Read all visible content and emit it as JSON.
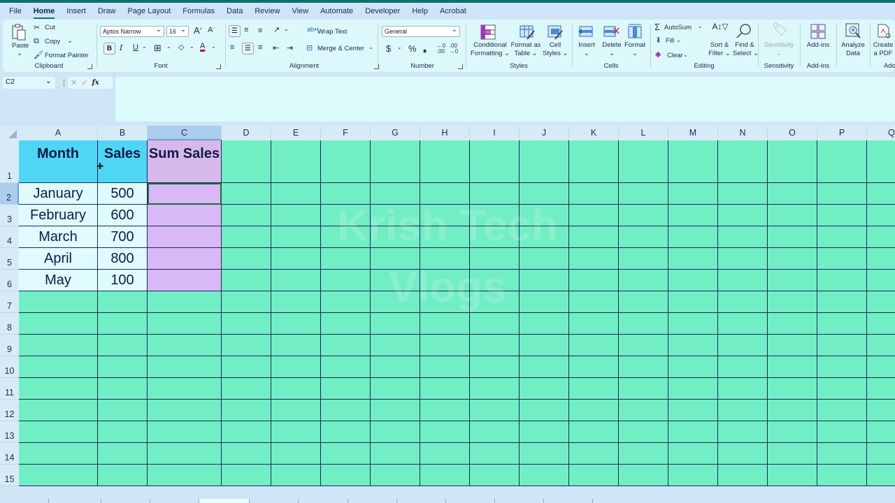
{
  "menu": {
    "tabs": [
      "File",
      "Home",
      "Insert",
      "Draw",
      "Page Layout",
      "Formulas",
      "Data",
      "Review",
      "View",
      "Automate",
      "Developer",
      "Help",
      "Acrobat"
    ],
    "active": "Home"
  },
  "ribbon": {
    "clipboard": {
      "paste": "Paste",
      "cut": "Cut",
      "copy": "Copy",
      "format_painter": "Format Painter",
      "label": "Clipboard"
    },
    "font": {
      "name": "Aptos Narrow",
      "size": "16",
      "bold": "B",
      "italic": "I",
      "underline": "U",
      "grow": "A",
      "shrink": "A",
      "label": "Font",
      "font_color": "#c0002a"
    },
    "alignment": {
      "wrap_text": "Wrap Text",
      "merge_center": "Merge & Center",
      "label": "Alignment"
    },
    "number": {
      "format": "General",
      "currency": "$",
      "percent": "%",
      "comma": "9",
      "inc_decimal": "←.0 .00",
      "dec_decimal": ".00 →.0",
      "label": "Number"
    },
    "styles": {
      "conditional": "Conditional",
      "conditional2": "Formatting",
      "format_table": "Format as",
      "format_table2": "Table",
      "cell_styles": "Cell",
      "cell_styles2": "Styles",
      "label": "Styles"
    },
    "cells": {
      "insert": "Insert",
      "delete": "Delete",
      "format": "Format",
      "label": "Cells"
    },
    "editing": {
      "autosum": "AutoSum",
      "fill": "Fill",
      "clear": "Clear",
      "sort": "Sort &",
      "sort2": "Filter",
      "find": "Find &",
      "find2": "Select",
      "label": "Editing"
    },
    "sensitivity": {
      "button": "Sensitivity",
      "label": "Sensitivity"
    },
    "addins": {
      "button": "Add-ins",
      "label": "Add-ins"
    },
    "analyze": {
      "button": "Analyze",
      "button2": "Data"
    },
    "adobe": {
      "button": "Create",
      "button2": "a PDF",
      "label": "Adob"
    }
  },
  "formula_bar": {
    "name_box": "C2",
    "fx": "fx",
    "value": ""
  },
  "sheet": {
    "columns": [
      "A",
      "B",
      "C",
      "D",
      "E",
      "F",
      "G",
      "H",
      "I",
      "J",
      "K",
      "L",
      "M",
      "N",
      "O",
      "P",
      "Q"
    ],
    "selected_column": "C",
    "rows": [
      "1",
      "2",
      "3",
      "4",
      "5",
      "6",
      "7",
      "8",
      "9",
      "10",
      "11",
      "12",
      "13",
      "14",
      "15"
    ],
    "selected_row": "2",
    "headers": [
      "Month",
      "Sales",
      "Sum Sales"
    ],
    "data": [
      {
        "month": "January",
        "sales": "500",
        "sum": ""
      },
      {
        "month": "February",
        "sales": "600",
        "sum": ""
      },
      {
        "month": "March",
        "sales": "700",
        "sum": ""
      },
      {
        "month": "April",
        "sales": "800",
        "sum": ""
      },
      {
        "month": "May",
        "sales": "100",
        "sum": ""
      }
    ],
    "active_cell": "C2"
  },
  "watermark": {
    "line1": "Krish Tech",
    "line2": "Vlogs"
  },
  "colors": {
    "grid_fill": "#72eec4",
    "header_fill": "#4fd6f4",
    "sum_fill": "#d8b8f6",
    "data_fill": "#dffbfd",
    "grid_line": "#1a2a5a"
  }
}
